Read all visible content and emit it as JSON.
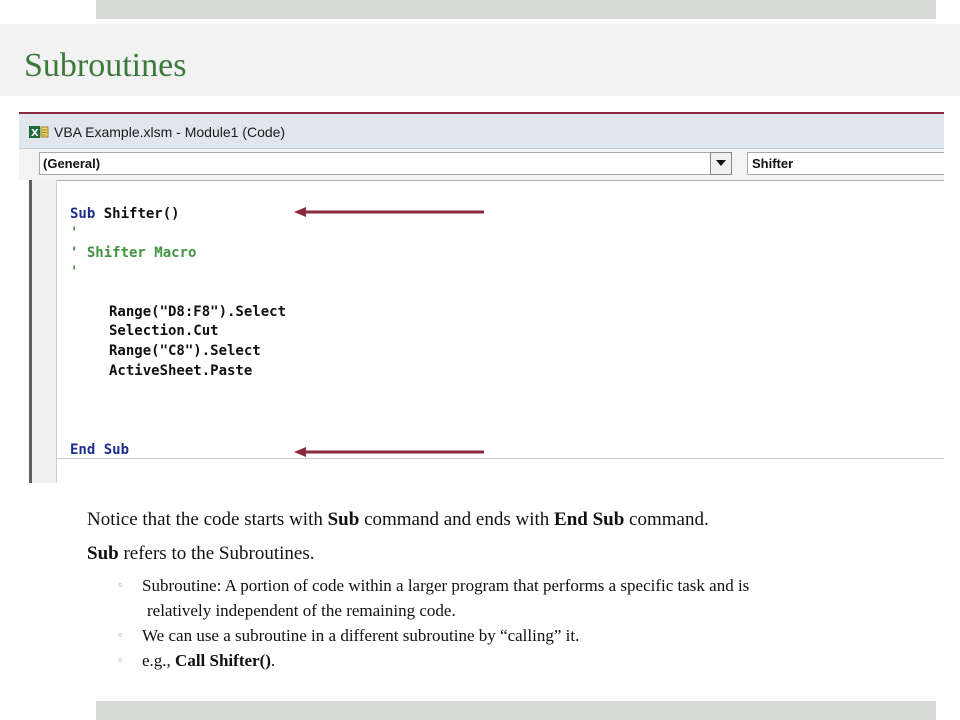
{
  "slide": {
    "title": "Subroutines"
  },
  "vba_window": {
    "title": "VBA Example.xlsm - Module1 (Code)",
    "object_combo": "(General)",
    "procedure_combo": "Shifter",
    "code": {
      "l1_keyword": "Sub",
      "l1_rest": " Shifter()",
      "l2": "'",
      "l3": "' Shifter Macro",
      "l4": "'",
      "l5": "Range(\"D8:F8\").Select",
      "l6": "Selection.Cut",
      "l7": "Range(\"C8\").Select",
      "l8": "ActiveSheet.Paste",
      "l9_keyword": "End Sub"
    },
    "arrow_color": "#8b2a3c"
  },
  "body": {
    "p1_a": "Notice that the code starts with ",
    "p1_b": "Sub",
    "p1_c": " command and ends with ",
    "p1_d": "End  Sub",
    "p1_e": " command.",
    "p2_a": "Sub",
    "p2_b": " refers to the Subroutines.",
    "bullet_glyph": "◦",
    "b1_line1": "Subroutine: A portion of code within a larger program that performs a specific task and is",
    "b1_line2": "relatively independent of the remaining code.",
    "b2": "We can use a subroutine in a different subroutine by “calling” it.",
    "b3_a": "e.g., ",
    "b3_b": "Call  Shifter()",
    "b3_c": "."
  },
  "colors": {
    "title": "#3c7a3c",
    "keyword": "#1d2e8f",
    "comment": "#3f9440",
    "accent_bars": "#d9dcd6"
  }
}
